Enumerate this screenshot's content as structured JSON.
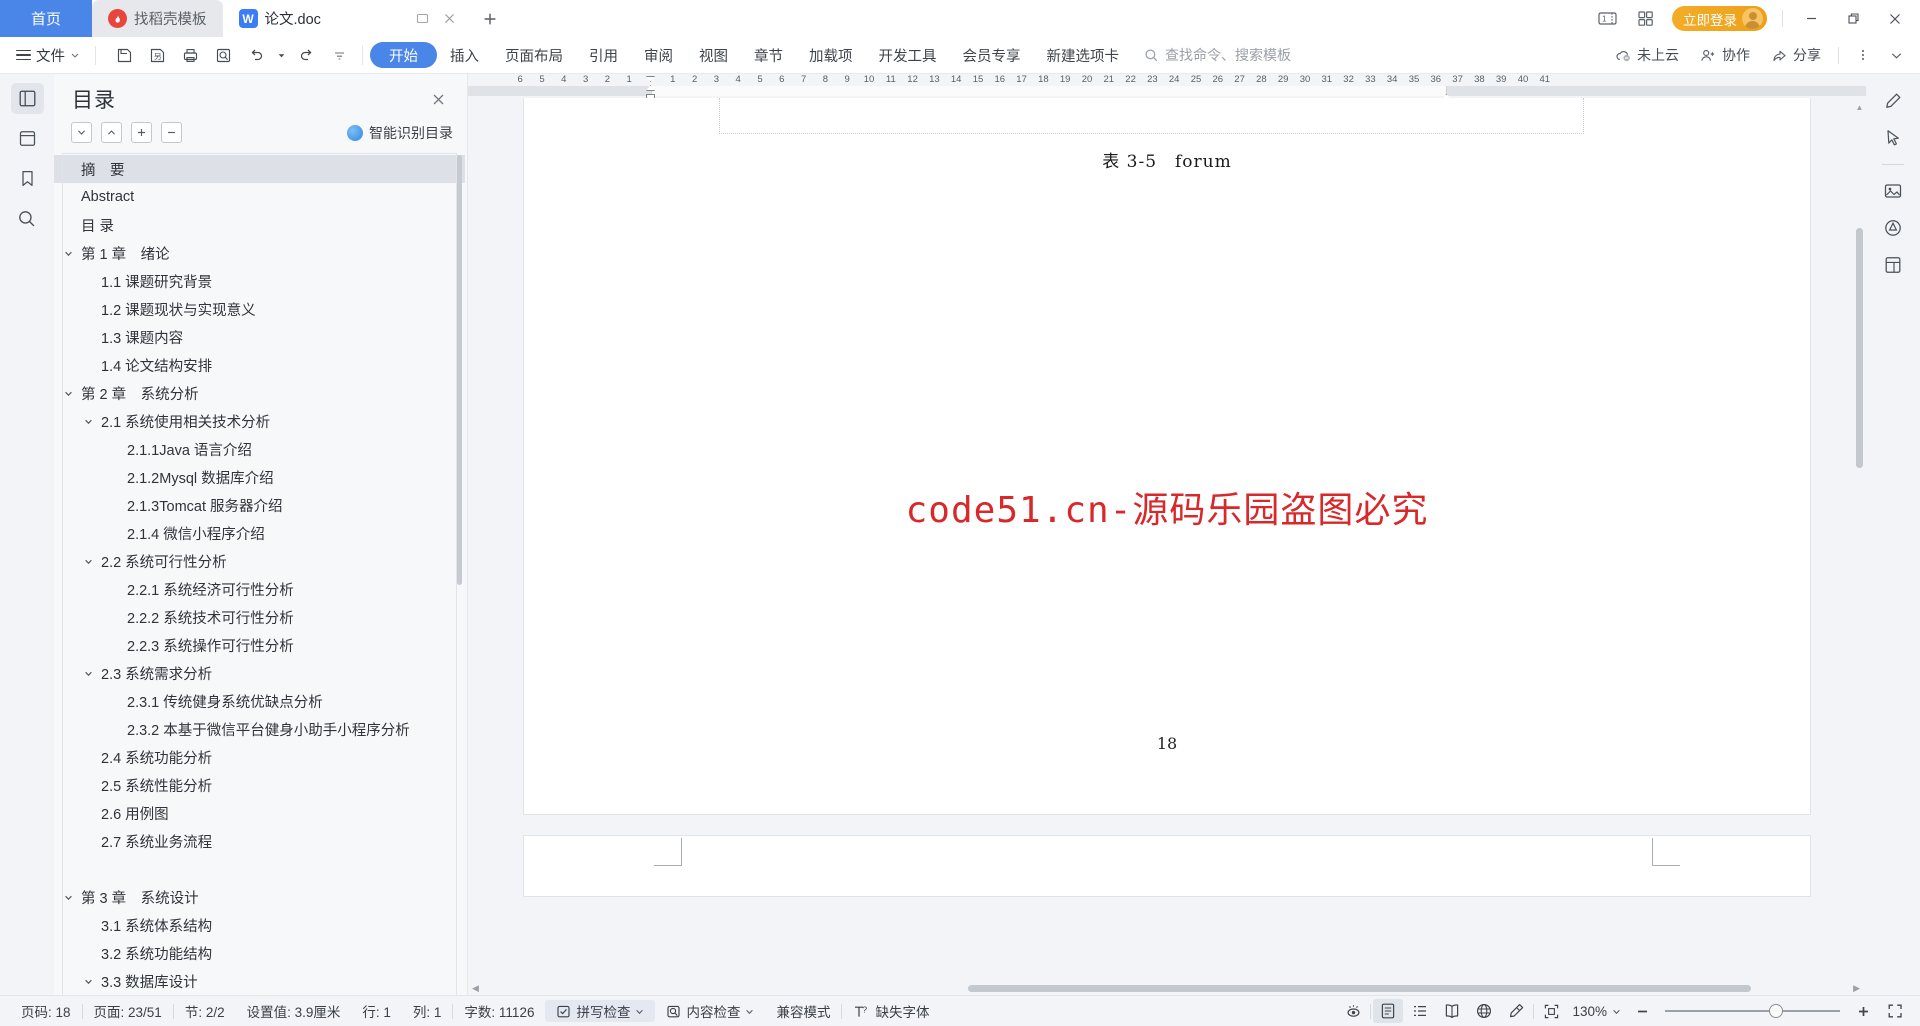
{
  "titlebar": {
    "home_tab": "首页",
    "tabs": [
      {
        "label": "找稻壳模板",
        "icon": "docer-icon",
        "state": "inactive"
      },
      {
        "label": "论文.doc",
        "icon": "wps-writer-icon",
        "state": "active"
      }
    ],
    "new_tab_icon": "plus-icon",
    "right_icons": [
      "tab-list-icon",
      "grid-icon"
    ],
    "login_label": "立即登录",
    "window_buttons": [
      "minimize",
      "restore",
      "close"
    ]
  },
  "ribbon": {
    "file_label": "文件",
    "quick_access": [
      "save-icon",
      "save-as-icon",
      "print-icon",
      "print-preview-icon",
      "undo-icon",
      "redo-icon",
      "customize-icon"
    ],
    "tabs": [
      {
        "label": "开始",
        "selected": true
      },
      {
        "label": "插入",
        "selected": false
      },
      {
        "label": "页面布局",
        "selected": false
      },
      {
        "label": "引用",
        "selected": false
      },
      {
        "label": "审阅",
        "selected": false
      },
      {
        "label": "视图",
        "selected": false
      },
      {
        "label": "章节",
        "selected": false
      },
      {
        "label": "加载项",
        "selected": false
      },
      {
        "label": "开发工具",
        "selected": false
      },
      {
        "label": "会员专享",
        "selected": false
      },
      {
        "label": "新建选项卡",
        "selected": false
      }
    ],
    "search_placeholder": "查找命令、搜索模板",
    "right_items": [
      {
        "label": "未上云",
        "icon": "cloud-off-icon"
      },
      {
        "label": "协作",
        "icon": "collaborate-icon"
      },
      {
        "label": "分享",
        "icon": "share-icon"
      }
    ],
    "more_icon": "more-vertical-icon",
    "collapse_icon": "chevron-down-icon"
  },
  "left_rail": {
    "items": [
      {
        "icon": "outline-panel-icon",
        "active": true
      },
      {
        "icon": "document-panel-icon",
        "active": false
      },
      {
        "icon": "bookmark-icon",
        "active": false
      },
      {
        "icon": "search-icon",
        "active": false
      }
    ]
  },
  "outline": {
    "title": "目录",
    "close_icon": "close-icon",
    "tools": [
      "expand-down-icon",
      "collapse-up-icon",
      "expand-all-icon",
      "collapse-all-icon"
    ],
    "smart_toc_label": "智能识别目录",
    "items": [
      {
        "label": "摘　要",
        "level": 1,
        "caret": "none",
        "selected": true
      },
      {
        "label": "Abstract",
        "level": 1,
        "caret": "none",
        "selected": false
      },
      {
        "label": "目 录",
        "level": 1,
        "caret": "none",
        "selected": false
      },
      {
        "label": "第 1 章　绪论",
        "level": 1,
        "caret": "down",
        "selected": false
      },
      {
        "label": "1.1 课题研究背景",
        "level": 2,
        "caret": "none",
        "selected": false
      },
      {
        "label": "1.2 课题现状与实现意义",
        "level": 2,
        "caret": "none",
        "selected": false
      },
      {
        "label": "1.3 课题内容",
        "level": 2,
        "caret": "none",
        "selected": false
      },
      {
        "label": "1.4 论文结构安排",
        "level": 2,
        "caret": "none",
        "selected": false
      },
      {
        "label": "第 2 章　系统分析",
        "level": 1,
        "caret": "down",
        "selected": false
      },
      {
        "label": "2.1 系统使用相关技术分析",
        "level": 2,
        "caret": "down",
        "selected": false
      },
      {
        "label": "2.1.1Java 语言介绍",
        "level": 3,
        "caret": "none",
        "selected": false
      },
      {
        "label": "2.1.2Mysql 数据库介绍",
        "level": 3,
        "caret": "none",
        "selected": false
      },
      {
        "label": "2.1.3Tomcat 服务器介绍",
        "level": 3,
        "caret": "none",
        "selected": false
      },
      {
        "label": "2.1.4 微信小程序介绍",
        "level": 3,
        "caret": "none",
        "selected": false
      },
      {
        "label": "2.2 系统可行性分析",
        "level": 2,
        "caret": "down",
        "selected": false
      },
      {
        "label": "2.2.1 系统经济可行性分析",
        "level": 3,
        "caret": "none",
        "selected": false
      },
      {
        "label": "2.2.2 系统技术可行性分析",
        "level": 3,
        "caret": "none",
        "selected": false
      },
      {
        "label": "2.2.3 系统操作可行性分析",
        "level": 3,
        "caret": "none",
        "selected": false
      },
      {
        "label": "2.3 系统需求分析",
        "level": 2,
        "caret": "down",
        "selected": false
      },
      {
        "label": "2.3.1 传统健身系统优缺点分析",
        "level": 3,
        "caret": "none",
        "selected": false
      },
      {
        "label": "2.3.2 本基于微信平台健身小助手小程序分析",
        "level": 3,
        "caret": "none",
        "selected": false
      },
      {
        "label": "2.4 系统功能分析",
        "level": 2,
        "caret": "none",
        "selected": false
      },
      {
        "label": "2.5 系统性能分析",
        "level": 2,
        "caret": "none",
        "selected": false
      },
      {
        "label": "2.6 用例图",
        "level": 2,
        "caret": "none",
        "selected": false
      },
      {
        "label": "2.7 系统业务流程",
        "level": 2,
        "caret": "none",
        "selected": false
      },
      {
        "label": "",
        "level": 1,
        "caret": "none",
        "selected": false
      },
      {
        "label": "第 3 章　系统设计",
        "level": 1,
        "caret": "down",
        "selected": false
      },
      {
        "label": "3.1 系统体系结构",
        "level": 2,
        "caret": "none",
        "selected": false
      },
      {
        "label": "3.2 系统功能结构",
        "level": 2,
        "caret": "none",
        "selected": false
      },
      {
        "label": "3.3 数据库设计",
        "level": 2,
        "caret": "down",
        "selected": false
      }
    ]
  },
  "ruler": {
    "left_marks": [
      6,
      5,
      4,
      3,
      2,
      1
    ],
    "right_marks": [
      1,
      2,
      3,
      4,
      5,
      6,
      7,
      8,
      9,
      10,
      11,
      12,
      13,
      14,
      15,
      16,
      17,
      18,
      19,
      20,
      21,
      22,
      23,
      24,
      25,
      26,
      27,
      28,
      29,
      30,
      31,
      32,
      33,
      34,
      35,
      36,
      37,
      38,
      39,
      40,
      41
    ]
  },
  "document": {
    "table_caption": "表 3-5　forum",
    "watermark": "code51.cn-源码乐园盗图必究",
    "watermark_color": "#d8282a",
    "page_number": "18"
  },
  "right_rail": {
    "items": [
      {
        "icon": "pen-tool-icon"
      },
      {
        "icon": "cursor-select-icon"
      },
      {
        "icon": "divider"
      },
      {
        "icon": "image-insert-icon"
      },
      {
        "icon": "shape-insert-icon"
      },
      {
        "icon": "page-layout-icon"
      }
    ]
  },
  "status": {
    "left_items": [
      {
        "label": "页码: 18",
        "name": "page-number-status"
      },
      {
        "label": "页面: 23/51",
        "name": "page-count-status"
      },
      {
        "label": "节: 2/2",
        "name": "section-status"
      },
      {
        "label": "设置值: 3.9厘米",
        "name": "measure-status"
      },
      {
        "label": "行: 1",
        "name": "line-status"
      },
      {
        "label": "列: 1",
        "name": "column-status"
      },
      {
        "label": "字数: 11126",
        "name": "word-count-status"
      },
      {
        "label": "拼写检查",
        "name": "spellcheck-status",
        "icon": "spellcheck-icon",
        "caret": true,
        "boxed": true
      },
      {
        "label": "内容检查",
        "name": "content-check-status",
        "icon": "content-check-icon",
        "caret": true
      },
      {
        "label": "兼容模式",
        "name": "compat-mode-status"
      },
      {
        "label": "缺失字体",
        "name": "missing-font-status",
        "icon": "missing-font-icon"
      }
    ],
    "right": {
      "eye_icon": "focus-eye-icon",
      "view_modes": [
        {
          "icon": "page-view-icon",
          "active": true
        },
        {
          "icon": "outline-view-icon",
          "active": false
        },
        {
          "icon": "reading-view-icon",
          "active": false
        },
        {
          "icon": "web-view-icon",
          "active": false
        },
        {
          "icon": "highlight-pen-icon",
          "active": false
        }
      ],
      "fit_icon": "fit-page-icon",
      "zoom_label": "130%",
      "zoom_minus": "−",
      "zoom_plus": "+",
      "fullscreen_icon": "fullscreen-icon"
    }
  }
}
